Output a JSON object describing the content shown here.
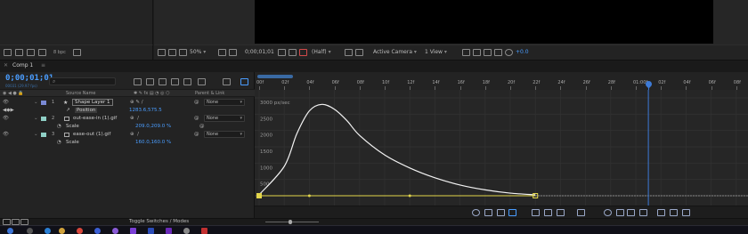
{
  "viewer": {
    "bpc": "8 bpc",
    "zoom": "50%",
    "timecode": "0;00;01;01",
    "resolution": "(Half)",
    "camera": "Active Camera",
    "view": "1 View",
    "exposure": "+0.0"
  },
  "tabs": {
    "comp": "Comp 1"
  },
  "timeline": {
    "current_time": "0;00;01;01",
    "frames_sub": "00031 (29.97 fps)",
    "search_placeholder": "",
    "columns": {
      "source_name": "Source Name",
      "parent_link": "Parent & Link"
    },
    "layers": [
      {
        "num": "1",
        "name": "Shape Layer 1",
        "parent": "None",
        "color": "#7a8ad6"
      },
      {
        "prop": "Position",
        "value": "1283.6,575.5"
      },
      {
        "num": "2",
        "name": "out-ease-in (1).gif",
        "parent": "None",
        "color": "#8fd0c6"
      },
      {
        "prop": "Scale",
        "value": "209.0,209.0 %"
      },
      {
        "num": "3",
        "name": "ease-out (1).gif",
        "parent": "None",
        "color": "#8fd0c6"
      },
      {
        "prop": "Scale",
        "value": "160.0,160.0 %"
      }
    ],
    "toggle_label": "Toggle Switches / Modes"
  },
  "ruler": {
    "ticks": [
      "00f",
      "02f",
      "04f",
      "06f",
      "08f",
      "10f",
      "12f",
      "14f",
      "16f",
      "18f",
      "20f",
      "22f",
      "24f",
      "26f",
      "28f",
      "01:00f",
      "02f",
      "04f",
      "06f",
      "08f"
    ]
  },
  "graph": {
    "y_labels": [
      "3000 px/sec",
      "2500",
      "2000",
      "1500",
      "1000",
      "500"
    ]
  },
  "chart_data": {
    "type": "line",
    "title": "",
    "xlabel": "",
    "ylabel": "",
    "unit": "px/sec",
    "x_unit": "frames",
    "ylim": [
      0,
      3000
    ],
    "x": [
      0,
      2,
      3,
      4,
      5,
      6,
      7,
      8,
      10,
      12,
      14,
      16,
      18,
      20,
      22
    ],
    "y": [
      30,
      900,
      1900,
      2600,
      2800,
      2650,
      2300,
      1850,
      1250,
      850,
      550,
      330,
      180,
      80,
      30
    ],
    "keyframes_x": [
      0,
      4,
      12,
      22
    ],
    "current_time_frame": 31
  },
  "colors": {
    "accent": "#4a9dff",
    "curve": "#f2f2f2",
    "keyframe": "#e3d64b",
    "cti": "#3d7ad6"
  }
}
